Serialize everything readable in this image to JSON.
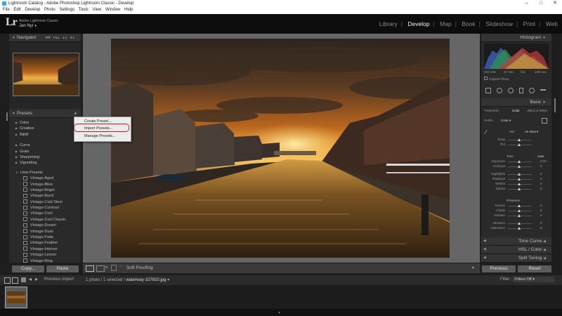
{
  "window": {
    "title": "Lightroom Catalog - Adobe Photoshop Lightroom Classic - Develop",
    "menu": [
      "File",
      "Edit",
      "Develop",
      "Photo",
      "Settings",
      "Tools",
      "View",
      "Window",
      "Help"
    ]
  },
  "identity_plate": {
    "logo": "Lr",
    "product": "Adobe Lightroom Classic",
    "user": "Jan Nyr"
  },
  "modules": [
    "Library",
    "Develop",
    "Map",
    "Book",
    "Slideshow",
    "Print",
    "Web"
  ],
  "active_module": "Develop",
  "navigator": {
    "label": "Navigator",
    "zoom_options": [
      "FIT",
      "FILL",
      "1:1",
      "3:1"
    ]
  },
  "presets": {
    "label": "Presets",
    "groups": [
      "Color",
      "Creative",
      "B&W",
      "Curve",
      "Grain",
      "Sharpening",
      "Vignetting"
    ],
    "user_presets_label": "User Presets",
    "user_presets": [
      "Vintage-Aged",
      "Vintage-Bliss",
      "Vintage-Bright",
      "Vintage-Burst",
      "Vintage-Cold Steel",
      "Vintage-Contrast",
      "Vintage-Cool",
      "Vintage-Cool Classic",
      "Vintage-Dream",
      "Vintage-Dusk",
      "Vintage-Fade",
      "Vintage-Feather",
      "Vintage-Intense",
      "Vintage-Lemon",
      "Vintage-Ring"
    ]
  },
  "context_menu": {
    "items": [
      "Create Preset...",
      "Import Presets...",
      "Manage Presets..."
    ],
    "highlighted": "Import Presets..."
  },
  "left_buttons": {
    "copy": "Copy...",
    "paste": "Paste"
  },
  "toolbar": {
    "soft_proofing": "Soft Proofing"
  },
  "histogram": {
    "label": "Histogram",
    "iso": "ISO 100",
    "focal": "17 mm",
    "aperture": "f/11",
    "shutter": "1/20 sec",
    "original_photo": "Original Photo"
  },
  "basic": {
    "label": "Basic",
    "treatment_label": "Treatment :",
    "treatment_color": "Color",
    "treatment_bw": "Black & White",
    "profile_label": "Profile :",
    "profile_value": "Color",
    "wb_label": "WB :",
    "wb_value": "As Shot",
    "temp_label": "Temp",
    "tint_label": "Tint",
    "tone_label": "Tone",
    "auto_label": "Auto",
    "exposure_label": "Exposure",
    "exposure_value": "0.00",
    "contrast_label": "Contrast",
    "highlights_label": "Highlights",
    "shadows_label": "Shadows",
    "whites_label": "Whites",
    "blacks_label": "Blacks",
    "presence_label": "Presence",
    "texture_label": "Texture",
    "clarity_label": "Clarity",
    "dehaze_label": "Dehaze",
    "vibrance_label": "Vibrance",
    "saturation_label": "Saturation",
    "zero": "0"
  },
  "right_sections": {
    "tone_curve": "Tone Curve",
    "hsl": "HSL / Color",
    "split_toning": "Split Toning"
  },
  "right_buttons": {
    "previous": "Previous",
    "reset": "Reset"
  },
  "filmstrip": {
    "source": "Previous Import",
    "info": "1 photo / 1 selected /",
    "filename": "waterway-107810.jpg",
    "filter_label": "Filter :",
    "filter_value": "Filters Off"
  },
  "colors": {
    "highlight_box": "#dd1111",
    "active_module": "#f0f0f0"
  }
}
